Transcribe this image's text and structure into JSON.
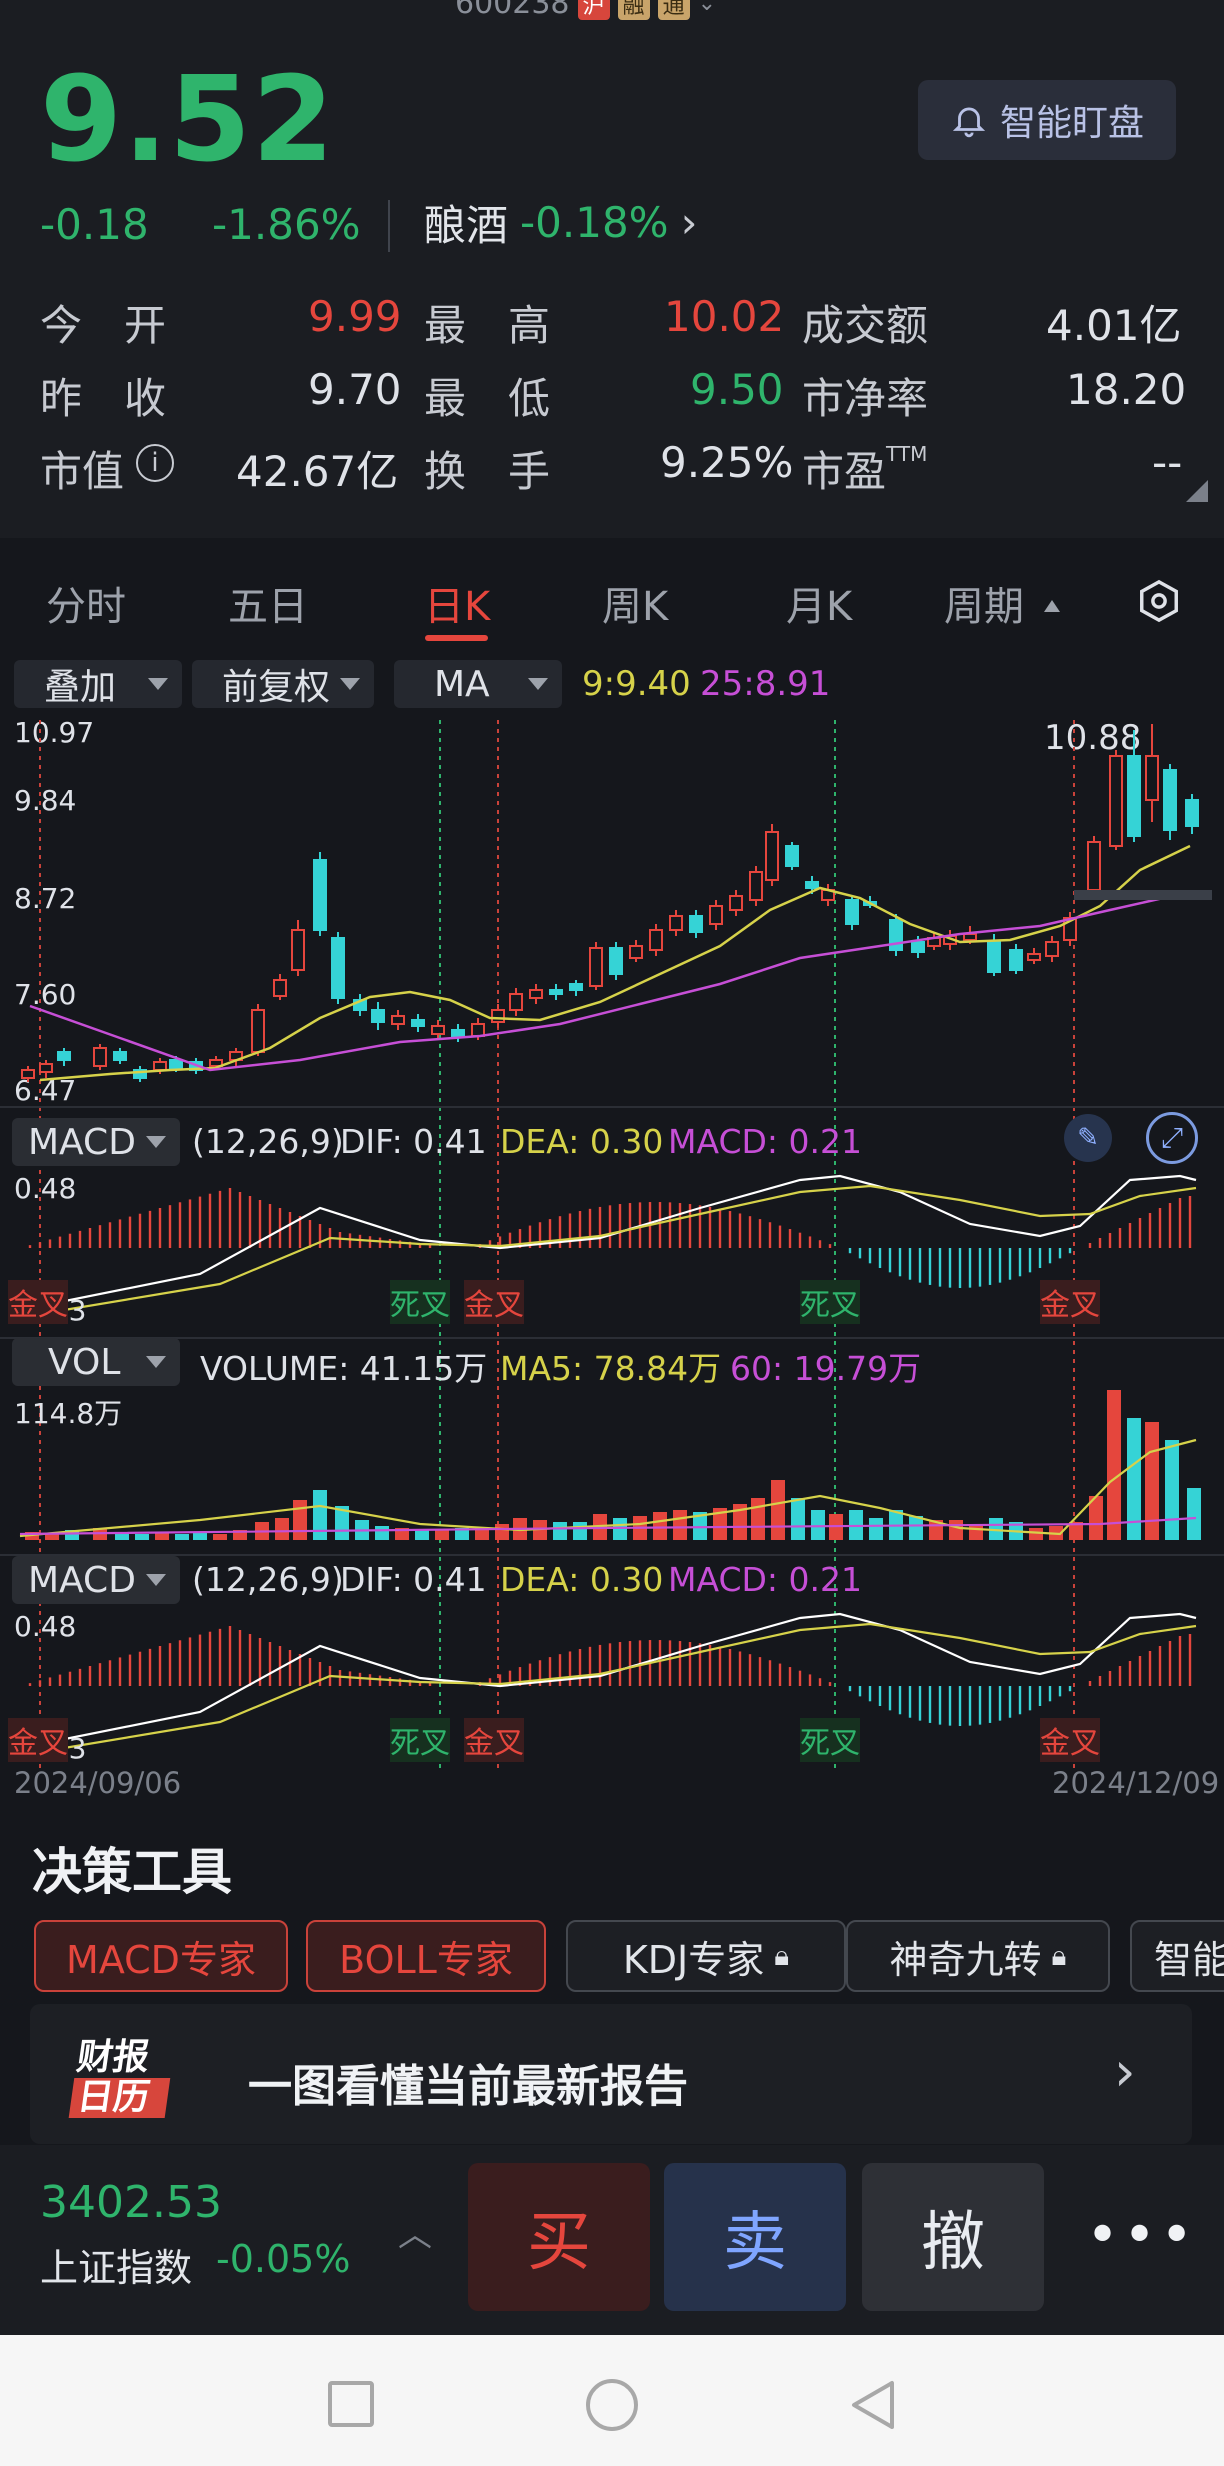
{
  "header": {
    "stock_code": "600238",
    "tag_1": "沪",
    "tag_2": "融",
    "tag_3": "通",
    "price": "9.52",
    "change": "-0.18",
    "change_pct": "-1.86%",
    "smart_watch": "智能盯盘",
    "industry": "酿酒",
    "industry_change": "-0.18%"
  },
  "stats": {
    "open_label": "今　开",
    "open_value": "9.99",
    "high_label": "最　高",
    "high_value": "10.02",
    "turnover_amt_label": "成交额",
    "turnover_amt_value": "4.01亿",
    "prev_close_label": "昨　收",
    "prev_close_value": "9.70",
    "low_label": "最　低",
    "low_value": "9.50",
    "pb_label": "市净率",
    "pb_value": "18.20",
    "mcap_label": "市值",
    "mcap_value": "42.67亿",
    "turnover_label": "换　手",
    "turnover_value": "9.25%",
    "pe_label": "市盈",
    "pe_tm": "TTM",
    "pe_value": "--"
  },
  "tabs": [
    "分时",
    "五日",
    "日K",
    "周K",
    "月K",
    "周期"
  ],
  "active_tab": "日K",
  "toolbar": {
    "overlay": "叠加",
    "adjust": "前复权",
    "ma": "MA",
    "ma9": "9:9.40",
    "ma25": "25:8.91"
  },
  "price_chart": {
    "y_labels": [
      "10.97",
      "9.84",
      "8.72",
      "7.60",
      "6.47"
    ],
    "max_label": "10.88"
  },
  "macd": {
    "name": "MACD",
    "params": "(12,26,9)",
    "dif": "DIF: 0.41",
    "dea": "DEA: 0.30",
    "macd": "MACD: 0.21",
    "top": "0.48",
    "bottom": "-0.43",
    "death_cross": "死叉",
    "golden_cross": "金叉"
  },
  "vol": {
    "name": "VOL",
    "volume": "VOLUME: 41.15万",
    "ma5": "MA5: 78.84万",
    "ma60": "60: 19.79万",
    "top": "114.8万"
  },
  "dates": {
    "start": "2024/09/06",
    "end": "2024/12/09"
  },
  "tools": {
    "title": "决策工具",
    "items": [
      "MACD专家",
      "BOLL专家",
      "KDJ专家",
      "神奇九转",
      "智能"
    ]
  },
  "banner": {
    "logo_top": "财报",
    "logo_bottom": "日历",
    "text": "一图看懂当前最新报告"
  },
  "index": {
    "value": "3402.53",
    "name": "上证指数",
    "change": "-0.05%"
  },
  "actions": {
    "buy": "买",
    "sell": "卖",
    "cancel": "撤"
  },
  "colors": {
    "up": "#e5463d",
    "down": "#2fb46c",
    "ma9": "#d6d24a",
    "ma25": "#c64fd6",
    "dif": "#ffffff"
  }
}
